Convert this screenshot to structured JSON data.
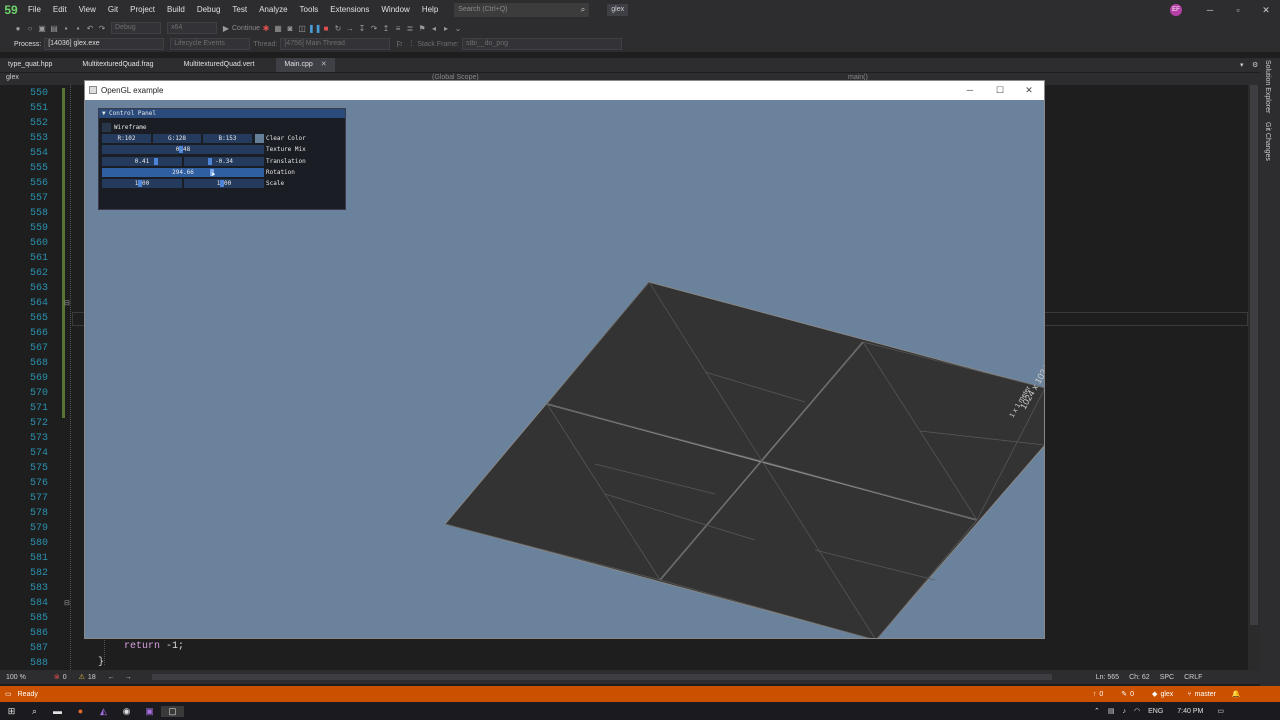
{
  "menubar": {
    "logo": "59",
    "items": [
      "File",
      "Edit",
      "View",
      "Git",
      "Project",
      "Build",
      "Debug",
      "Test",
      "Analyze",
      "Tools",
      "Extensions",
      "Window",
      "Help"
    ],
    "search_placeholder": "Search (Ctrl+Q)",
    "solution_name": "glex",
    "avatar_initials": "EF"
  },
  "toolbar": {
    "config": "Debug",
    "platform": "x64",
    "continue_label": "Continue",
    "lifecycle": "Lifecycle Events",
    "thread_label": "Thread:",
    "thread_value": "[4756] Main Thread",
    "stack_frame_label": "Stack Frame:",
    "stack_frame_value": "stbi__do_png"
  },
  "process": {
    "label": "Process:",
    "value": "[14036] glex.exe"
  },
  "tabs": [
    {
      "label": "type_quat.hpp"
    },
    {
      "label": "MultitexturedQuad.frag"
    },
    {
      "label": "MultitexturedQuad.vert"
    },
    {
      "label": "Main.cpp"
    }
  ],
  "doc_nav": {
    "project": "glex",
    "scope": "(Global Scope)",
    "member": "main()"
  },
  "editor": {
    "line_numbers": [
      "550",
      "551",
      "552",
      "553",
      "554",
      "555",
      "556",
      "557",
      "558",
      "559",
      "560",
      "561",
      "562",
      "563",
      "564",
      "565",
      "566",
      "567",
      "568",
      "569",
      "570",
      "571",
      "572",
      "573",
      "574",
      "575",
      "576",
      "577",
      "578",
      "579",
      "580",
      "581",
      "582",
      "583",
      "584",
      "585",
      "586",
      "587",
      "588"
    ],
    "code_return_kw": "return",
    "code_return_rest": " -1;",
    "code_brace": "}"
  },
  "right_rail": {
    "solution_explorer": "Solution Explorer",
    "git_changes": "Git Changes"
  },
  "hscroll": {
    "zoom": "100 %",
    "errors": "0",
    "warnings": "18",
    "line": "Ln: 565",
    "col": "Ch: 62",
    "spc": "SPC",
    "eol": "CRLF"
  },
  "status": {
    "ready": "Ready",
    "up_count": "0",
    "pencil_count": "0",
    "repo": "glex",
    "branch": "master"
  },
  "taskbar": {
    "lang": "ENG",
    "time": "7:40 PM"
  },
  "gl_window": {
    "title": "OpenGL example",
    "background": "#6a829b"
  },
  "control_panel": {
    "title": "Control Panel",
    "wireframe_label": "Wireframe",
    "clear_r": "R:102",
    "clear_g": "G:128",
    "clear_b": "B:153",
    "clear_color_label": "Clear Color",
    "clear_color": "#667f99",
    "texture_mix_value": "0.48",
    "texture_mix_label": "Texture Mix",
    "translation_x": "0.41",
    "translation_y": "-0.34",
    "translation_label": "Translation",
    "rotation_value": "294.66",
    "rotation_label": "Rotation",
    "scale_x": "1.00",
    "scale_y": "1.00",
    "scale_label": "Scale"
  },
  "quad": {
    "texture_text": "1024 x 1024",
    "texture_subtext": "1 x 1 meter"
  },
  "colors": {
    "status_bar": "#ca5100",
    "editor_bg": "#1e1e1e",
    "line_number": "#2b91af"
  }
}
